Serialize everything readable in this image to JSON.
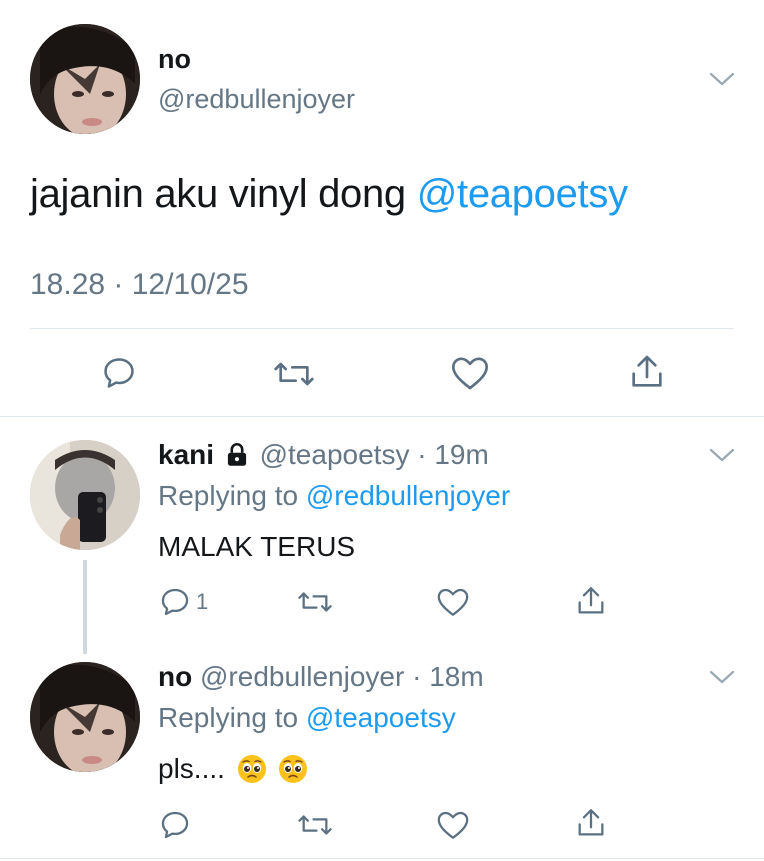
{
  "main_tweet": {
    "display_name": "no",
    "handle": "@redbullenjoyer",
    "text_plain": "jajanin aku vinyl dong ",
    "text_mention": "@teapoetsy",
    "timestamp": "18.28 · 12/10/25"
  },
  "replies": [
    {
      "display_name": "kani",
      "handle": "@teapoetsy",
      "time": "· 19m",
      "replying_prefix": "Replying to ",
      "replying_handle": "@redbullenjoyer",
      "text": "MALAK TERUS",
      "reply_count": "1",
      "locked": true
    },
    {
      "display_name": "no",
      "handle": "@redbullenjoyer",
      "time": "· 18m",
      "replying_prefix": "Replying to ",
      "replying_handle": "@teapoetsy",
      "text": "pls....",
      "emoji": [
        "pleading-face",
        "pleading-face"
      ]
    }
  ],
  "colors": {
    "link": "#1d9bf0",
    "secondary_text": "#657786",
    "primary_text": "#14171a",
    "divider": "#e1e8ed"
  },
  "icons": [
    "chevron-down-icon",
    "reply-icon",
    "retweet-icon",
    "like-icon",
    "share-icon",
    "lock-icon"
  ]
}
